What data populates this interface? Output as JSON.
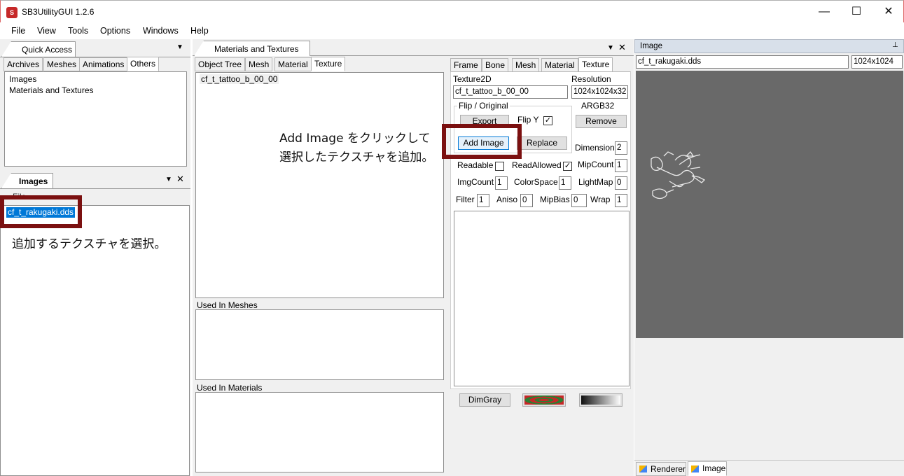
{
  "window": {
    "title": "SB3UtilityGUI 1.2.6",
    "minimize": "—",
    "maximize": "☐",
    "close": "✕"
  },
  "menu": [
    "File",
    "View",
    "Tools",
    "Options",
    "Windows",
    "Help"
  ],
  "quick_access": {
    "title": "Quick Access",
    "tabs": [
      "Archives",
      "Meshes",
      "Animations",
      "Others"
    ],
    "items": [
      "Images",
      "Materials and Textures"
    ]
  },
  "images_panel": {
    "title": "Images",
    "column": "File",
    "selected_file": "cf_t_rakugaki.dds"
  },
  "materials_panel": {
    "title": "Materials and Textures",
    "tabs": [
      "Object Tree",
      "Mesh",
      "Material",
      "Texture"
    ],
    "texture_item": "cf_t_tattoo_b_00_00",
    "used_in_meshes": "Used In Meshes",
    "used_in_materials": "Used In Materials"
  },
  "editor": {
    "tabs": [
      "Frame",
      "Bone",
      "Mesh",
      "Material",
      "Texture"
    ],
    "texture2d_label": "Texture2D",
    "texture2d_value": "cf_t_tattoo_b_00_00",
    "resolution_label": "Resolution",
    "resolution_value": "1024x1024x32",
    "format": "ARGB32",
    "flip_group": "Flip / Original",
    "export_button": "Export",
    "flip_y_label": "Flip Y",
    "flip_y_checked": "✓",
    "remove_button": "Remove",
    "add_image_button": "Add Image",
    "replace_button": "Replace",
    "dimension_label": "Dimension",
    "dimension_value": "2",
    "readable_label": "Readable",
    "readable_checked": "",
    "readallowed_label": "ReadAllowed",
    "readallowed_checked": "✓",
    "mipcount_label": "MipCount",
    "mipcount_value": "1",
    "imgcount_label": "ImgCount",
    "imgcount_value": "1",
    "colorspace_label": "ColorSpace",
    "colorspace_value": "1",
    "lightmap_label": "LightMap",
    "lightmap_value": "0",
    "filter_label": "Filter",
    "filter_value": "1",
    "aniso_label": "Aniso",
    "aniso_value": "0",
    "mipbias_label": "MipBias",
    "mipbias_value": "0",
    "wrap_label": "Wrap",
    "wrap_value": "1",
    "dimgray_button": "DimGray"
  },
  "image_panel": {
    "title": "Image",
    "pin": "📌",
    "filename": "cf_t_rakugaki.dds",
    "size": "1024x1024",
    "bottom_tabs": [
      "Renderer",
      "Image"
    ]
  },
  "annotations": {
    "add_image_line1": "Add Image をクリックして",
    "add_image_line2": "選択したテクスチャを追加。",
    "select_texture": "追加するテクスチャを選択。"
  },
  "colors": {
    "annotation": "#7b1010",
    "selection": "#0078d7",
    "preview_bg": "#696969"
  }
}
